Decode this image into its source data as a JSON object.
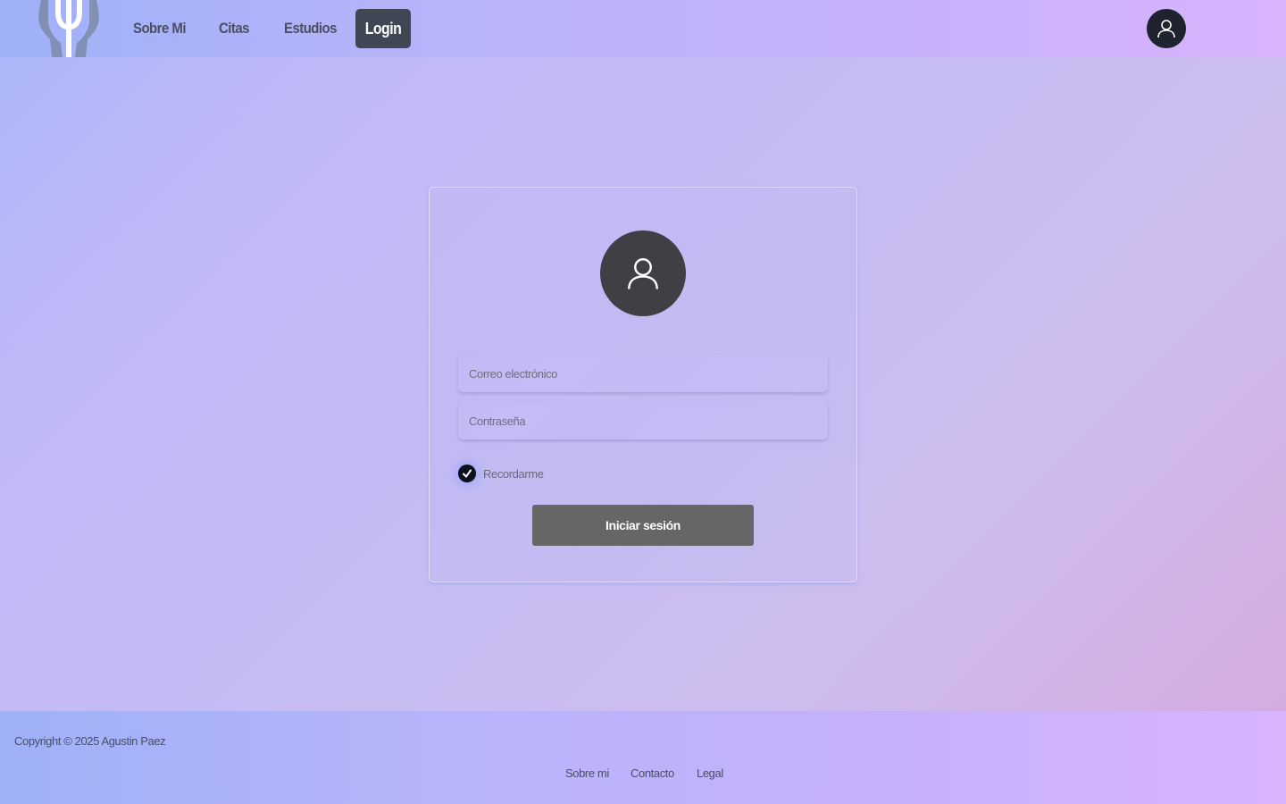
{
  "colors": {
    "nav_text": "#4a4f63",
    "login_active_bg": "#3f4654",
    "avatar_bg": "#3f3f44",
    "submit_bg": "#666666"
  },
  "header": {
    "logo_icon": "psi-head-logo",
    "nav": {
      "about": "Sobre Mi",
      "appointments": "Citas",
      "studies": "Estudios",
      "login": "Login"
    },
    "user_icon": "user-icon"
  },
  "login_form": {
    "avatar_icon": "user-icon",
    "email_placeholder": "Correo electrónico",
    "password_placeholder": "Contraseña",
    "remember_label": "Recordarme",
    "remember_checked": true,
    "submit_label": "Iniciar sesión"
  },
  "footer": {
    "copyright": "Copyright © 2025 Agustin Paez",
    "links": {
      "about": "Sobre mi",
      "contact": "Contacto",
      "legal": "Legal"
    }
  }
}
